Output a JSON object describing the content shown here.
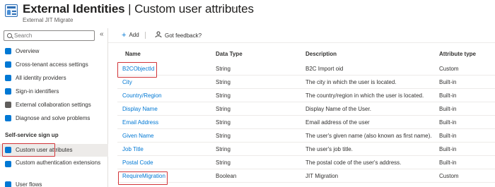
{
  "header": {
    "title_main": "External Identities",
    "title_rest": " | Custom user attributes",
    "more": "···",
    "subtitle": "External JIT Migrate"
  },
  "sidebar": {
    "search_placeholder": "Search",
    "collapse": "«",
    "items": [
      {
        "label": "Overview",
        "icon": "info-icon",
        "color": "#0078d4"
      },
      {
        "label": "Cross-tenant access settings",
        "icon": "globe-icon",
        "color": "#0078d4"
      },
      {
        "label": "All identity providers",
        "icon": "users-icon",
        "color": "#0078d4"
      },
      {
        "label": "Sign-in identifiers",
        "icon": "id-icon",
        "color": "#0078d4"
      },
      {
        "label": "External collaboration settings",
        "icon": "gear-icon",
        "color": "#605e5c"
      },
      {
        "label": "Diagnose and solve problems",
        "icon": "wrench-icon",
        "color": "#0078d4"
      }
    ],
    "section_title": "Self-service sign up",
    "section_items": [
      {
        "label": "Custom user attributes",
        "icon": "list-icon",
        "color": "#0078d4"
      },
      {
        "label": "Custom authentication extensions",
        "icon": "extension-icon",
        "color": "#0078d4"
      },
      {
        "label": "User flows",
        "icon": "flow-icon",
        "color": "#0078d4"
      }
    ]
  },
  "toolbar": {
    "add_label": "Add",
    "feedback_label": "Got feedback?"
  },
  "table": {
    "headers": [
      "Name",
      "Data Type",
      "Description",
      "Attribute type"
    ],
    "rows": [
      [
        "B2CObjectId",
        "String",
        "B2C Import oid",
        "Custom"
      ],
      [
        "City",
        "String",
        "The city in which the user is located.",
        "Built-in"
      ],
      [
        "Country/Region",
        "String",
        "The country/region in which the user is located.",
        "Built-in"
      ],
      [
        "Display Name",
        "String",
        "Display Name of the User.",
        "Built-in"
      ],
      [
        "Email Address",
        "String",
        "Email address of the user",
        "Built-in"
      ],
      [
        "Given Name",
        "String",
        "The user's given name (also known as first name).",
        "Built-in"
      ],
      [
        "Job Title",
        "String",
        "The user's job title.",
        "Built-in"
      ],
      [
        "Postal Code",
        "String",
        "The postal code of the user's address.",
        "Built-in"
      ],
      [
        "RequireMigration",
        "Boolean",
        "JIT Migration",
        "Custom"
      ]
    ]
  },
  "colors": {
    "link": "#0078d4",
    "highlight": "#d13438",
    "active_bg": "#edebe9"
  }
}
